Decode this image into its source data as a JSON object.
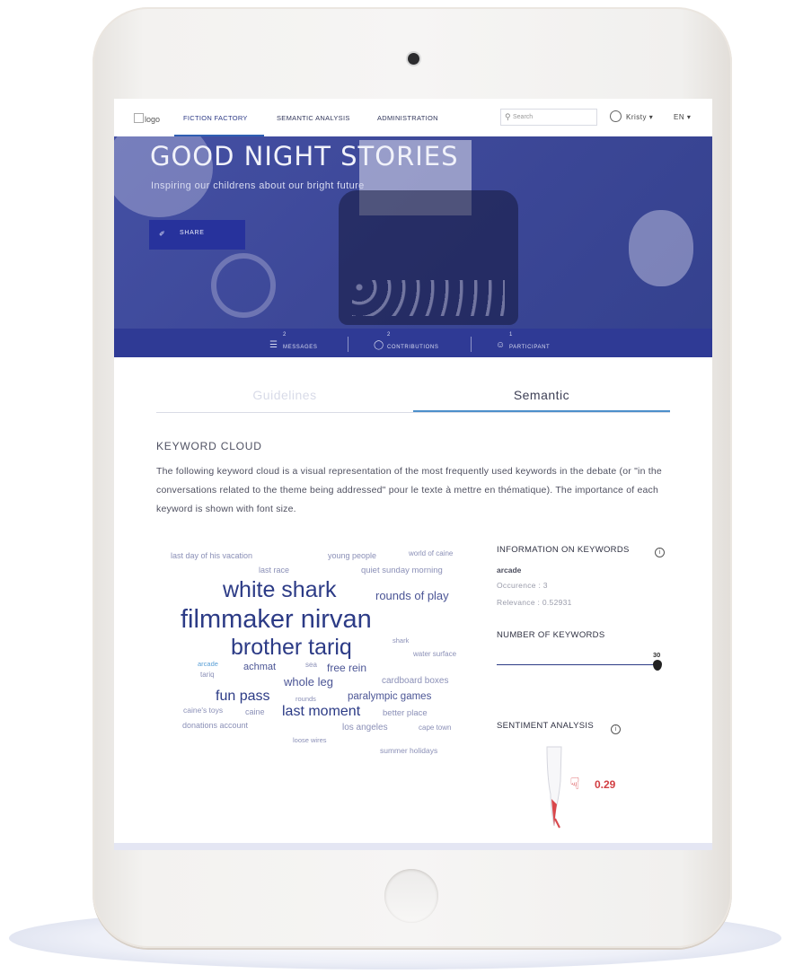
{
  "nav": {
    "logo_alt": "logo",
    "items": [
      {
        "label": "FICTION FACTORY",
        "active": true
      },
      {
        "label": "SEMANTIC ANALYSIS",
        "active": false
      },
      {
        "label": "ADMINISTRATION",
        "active": false
      }
    ],
    "search_placeholder": "Search",
    "user_name": "Kristy",
    "language": "EN"
  },
  "hero": {
    "title": "GOOD NIGHT STORIES",
    "subtitle": "Inspiring our childrens about our bright future",
    "share_label": "SHARE",
    "stats": [
      {
        "count": "2",
        "label": "MESSAGES",
        "icon": "messages-icon"
      },
      {
        "count": "2",
        "label": "CONTRIBUTIONS",
        "icon": "contributions-icon"
      },
      {
        "count": "1",
        "label": "PARTICIPANT",
        "icon": "participant-icon"
      }
    ]
  },
  "tabs": [
    {
      "label": "Guidelines",
      "active": false
    },
    {
      "label": "Semantic",
      "active": true
    }
  ],
  "keyword_cloud": {
    "title": "KEYWORD CLOUD",
    "description": "The following keyword cloud is a visual representation of the most frequently used keywords in the debate (or \"in the conversations related to the theme being addressed\" pour le texte à mettre en thématique). The importance of each keyword is shown with font size.",
    "words": [
      {
        "text": "last day of his vacation"
      },
      {
        "text": "young people"
      },
      {
        "text": "world of caine"
      },
      {
        "text": "last race"
      },
      {
        "text": "quiet sunday morning"
      },
      {
        "text": "white shark"
      },
      {
        "text": "rounds of play"
      },
      {
        "text": "filmmaker nirvan"
      },
      {
        "text": "brother tariq"
      },
      {
        "text": "shark"
      },
      {
        "text": "water surface"
      },
      {
        "text": "arcade"
      },
      {
        "text": "achmat"
      },
      {
        "text": "sea"
      },
      {
        "text": "free rein"
      },
      {
        "text": "tariq"
      },
      {
        "text": "cardboard boxes"
      },
      {
        "text": "whole leg"
      },
      {
        "text": "fun pass"
      },
      {
        "text": "rounds"
      },
      {
        "text": "paralympic games"
      },
      {
        "text": "caine's toys"
      },
      {
        "text": "caine"
      },
      {
        "text": "last moment"
      },
      {
        "text": "better place"
      },
      {
        "text": "donations account"
      },
      {
        "text": "los angeles"
      },
      {
        "text": "cape town"
      },
      {
        "text": "loose wires"
      },
      {
        "text": "summer holidays"
      }
    ]
  },
  "info": {
    "title": "INFORMATION ON KEYWORDS",
    "keyword": "arcade",
    "occurrence": "Occurence : 3",
    "relevance": "Relevance : 0.52931"
  },
  "number_of_keywords": {
    "title": "NUMBER OF KEYWORDS",
    "value": "30",
    "fraction": 1.0
  },
  "sentiment": {
    "title": "SENTIMENT ANALYSIS",
    "value": "0.29",
    "icon": "thumbs-down-icon",
    "color": "#d23f43"
  }
}
